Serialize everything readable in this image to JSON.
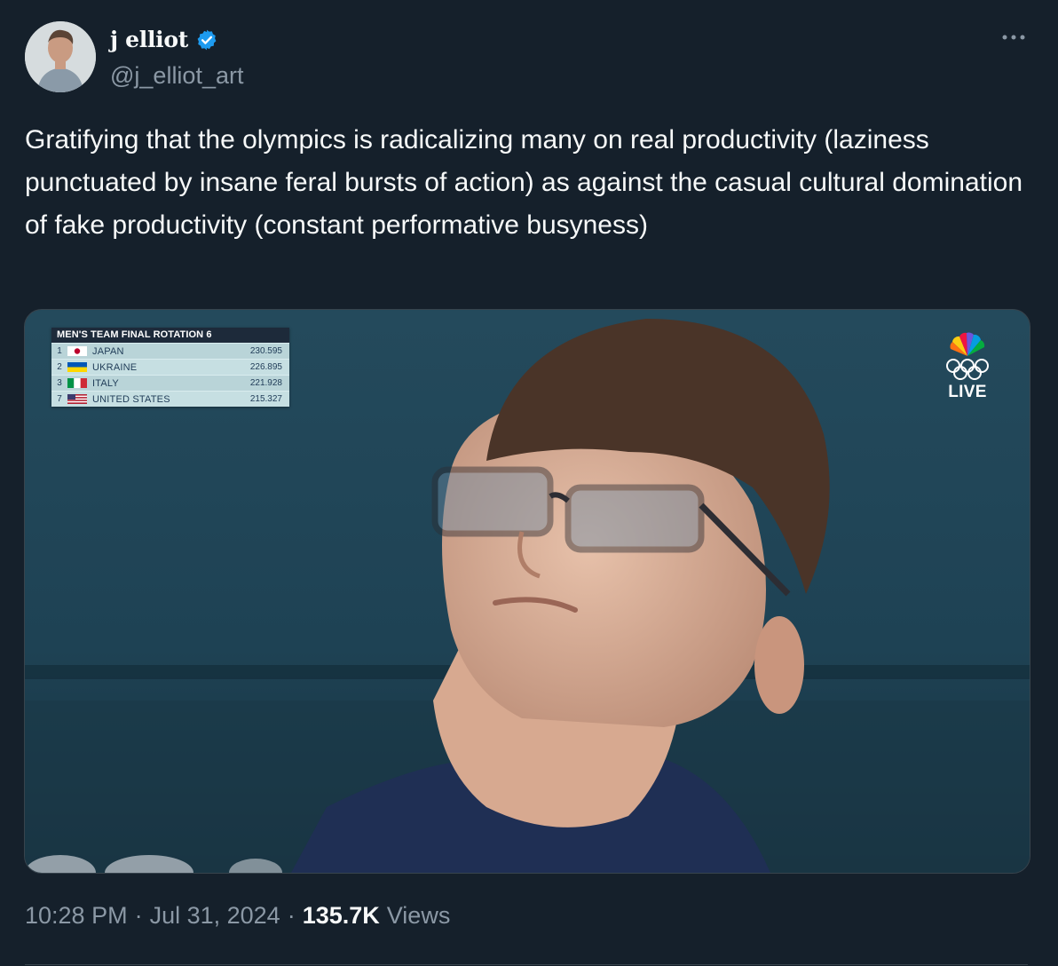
{
  "author": {
    "display_name": "j elliot",
    "handle": "@j_elliot_art",
    "verified": true,
    "verified_color": "#1d9bf0"
  },
  "tweet": {
    "text": "Gratifying that the olympics is radicalizing many on real productivity (laziness punctuated by insane feral bursts of action) as against the casual cultural domination of fake productivity (constant performative busyness)"
  },
  "media": {
    "scoreboard": {
      "title": "MEN'S TEAM FINAL  ROTATION 6",
      "rows": [
        {
          "rank": "1",
          "country": "JAPAN",
          "score": "230.595",
          "flag": "japan-flag-icon"
        },
        {
          "rank": "2",
          "country": "UKRAINE",
          "score": "226.895",
          "flag": "ukraine-flag-icon"
        },
        {
          "rank": "3",
          "country": "ITALY",
          "score": "221.928",
          "flag": "italy-flag-icon"
        },
        {
          "rank": "7",
          "country": "UNITED STATES",
          "score": "215.327",
          "flag": "usa-flag-icon"
        }
      ]
    },
    "broadcast": {
      "live_label": "LIVE",
      "logo": "peacock-logo-icon",
      "rings": "olympic-rings-icon"
    }
  },
  "meta": {
    "time": "10:28 PM",
    "separator": "·",
    "date": "Jul 31, 2024",
    "views_count": "135.7K",
    "views_label": "Views"
  },
  "colors": {
    "background": "#15202b",
    "text": "#f7f9f9",
    "secondary_text": "#8b98a5",
    "border": "#38444d"
  }
}
